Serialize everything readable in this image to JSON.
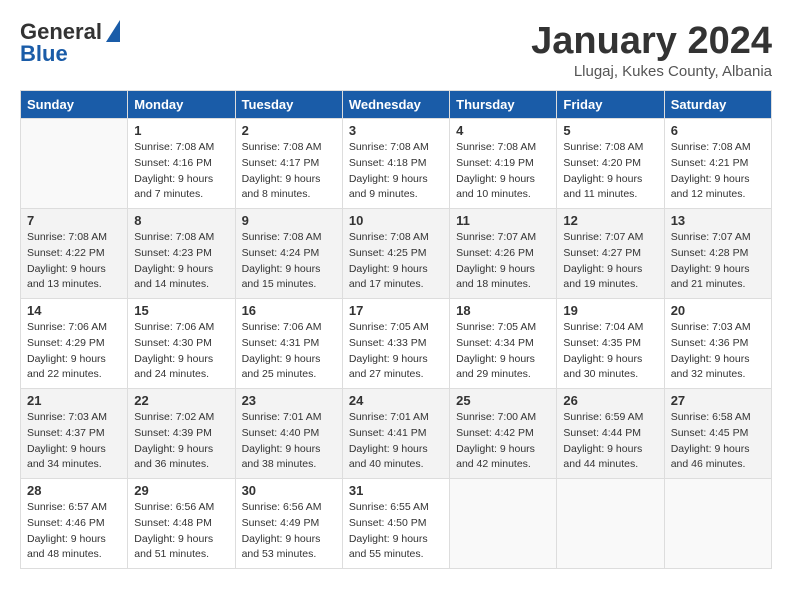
{
  "header": {
    "logo_line1": "General",
    "logo_line2": "Blue",
    "month": "January 2024",
    "location": "Llugaj, Kukes County, Albania"
  },
  "days_of_week": [
    "Sunday",
    "Monday",
    "Tuesday",
    "Wednesday",
    "Thursday",
    "Friday",
    "Saturday"
  ],
  "weeks": [
    [
      {
        "day": "",
        "sunrise": "",
        "sunset": "",
        "daylight": ""
      },
      {
        "day": "1",
        "sunrise": "Sunrise: 7:08 AM",
        "sunset": "Sunset: 4:16 PM",
        "daylight": "Daylight: 9 hours and 7 minutes."
      },
      {
        "day": "2",
        "sunrise": "Sunrise: 7:08 AM",
        "sunset": "Sunset: 4:17 PM",
        "daylight": "Daylight: 9 hours and 8 minutes."
      },
      {
        "day": "3",
        "sunrise": "Sunrise: 7:08 AM",
        "sunset": "Sunset: 4:18 PM",
        "daylight": "Daylight: 9 hours and 9 minutes."
      },
      {
        "day": "4",
        "sunrise": "Sunrise: 7:08 AM",
        "sunset": "Sunset: 4:19 PM",
        "daylight": "Daylight: 9 hours and 10 minutes."
      },
      {
        "day": "5",
        "sunrise": "Sunrise: 7:08 AM",
        "sunset": "Sunset: 4:20 PM",
        "daylight": "Daylight: 9 hours and 11 minutes."
      },
      {
        "day": "6",
        "sunrise": "Sunrise: 7:08 AM",
        "sunset": "Sunset: 4:21 PM",
        "daylight": "Daylight: 9 hours and 12 minutes."
      }
    ],
    [
      {
        "day": "7",
        "sunrise": "",
        "sunset": "",
        "daylight": ""
      },
      {
        "day": "8",
        "sunrise": "Sunrise: 7:08 AM",
        "sunset": "Sunset: 4:23 PM",
        "daylight": "Daylight: 9 hours and 14 minutes."
      },
      {
        "day": "9",
        "sunrise": "Sunrise: 7:08 AM",
        "sunset": "Sunset: 4:24 PM",
        "daylight": "Daylight: 9 hours and 15 minutes."
      },
      {
        "day": "10",
        "sunrise": "Sunrise: 7:08 AM",
        "sunset": "Sunset: 4:25 PM",
        "daylight": "Daylight: 9 hours and 17 minutes."
      },
      {
        "day": "11",
        "sunrise": "Sunrise: 7:07 AM",
        "sunset": "Sunset: 4:26 PM",
        "daylight": "Daylight: 9 hours and 18 minutes."
      },
      {
        "day": "12",
        "sunrise": "Sunrise: 7:07 AM",
        "sunset": "Sunset: 4:27 PM",
        "daylight": "Daylight: 9 hours and 19 minutes."
      },
      {
        "day": "13",
        "sunrise": "Sunrise: 7:07 AM",
        "sunset": "Sunset: 4:28 PM",
        "daylight": "Daylight: 9 hours and 21 minutes."
      }
    ],
    [
      {
        "day": "14",
        "sunrise": "",
        "sunset": "",
        "daylight": ""
      },
      {
        "day": "15",
        "sunrise": "Sunrise: 7:06 AM",
        "sunset": "Sunset: 4:30 PM",
        "daylight": "Daylight: 9 hours and 24 minutes."
      },
      {
        "day": "16",
        "sunrise": "Sunrise: 7:06 AM",
        "sunset": "Sunset: 4:31 PM",
        "daylight": "Daylight: 9 hours and 25 minutes."
      },
      {
        "day": "17",
        "sunrise": "Sunrise: 7:05 AM",
        "sunset": "Sunset: 4:33 PM",
        "daylight": "Daylight: 9 hours and 27 minutes."
      },
      {
        "day": "18",
        "sunrise": "Sunrise: 7:05 AM",
        "sunset": "Sunset: 4:34 PM",
        "daylight": "Daylight: 9 hours and 29 minutes."
      },
      {
        "day": "19",
        "sunrise": "Sunrise: 7:04 AM",
        "sunset": "Sunset: 4:35 PM",
        "daylight": "Daylight: 9 hours and 30 minutes."
      },
      {
        "day": "20",
        "sunrise": "Sunrise: 7:03 AM",
        "sunset": "Sunset: 4:36 PM",
        "daylight": "Daylight: 9 hours and 32 minutes."
      }
    ],
    [
      {
        "day": "21",
        "sunrise": "",
        "sunset": "",
        "daylight": ""
      },
      {
        "day": "22",
        "sunrise": "Sunrise: 7:02 AM",
        "sunset": "Sunset: 4:39 PM",
        "daylight": "Daylight: 9 hours and 36 minutes."
      },
      {
        "day": "23",
        "sunrise": "Sunrise: 7:01 AM",
        "sunset": "Sunset: 4:40 PM",
        "daylight": "Daylight: 9 hours and 38 minutes."
      },
      {
        "day": "24",
        "sunrise": "Sunrise: 7:01 AM",
        "sunset": "Sunset: 4:41 PM",
        "daylight": "Daylight: 9 hours and 40 minutes."
      },
      {
        "day": "25",
        "sunrise": "Sunrise: 7:00 AM",
        "sunset": "Sunset: 4:42 PM",
        "daylight": "Daylight: 9 hours and 42 minutes."
      },
      {
        "day": "26",
        "sunrise": "Sunrise: 6:59 AM",
        "sunset": "Sunset: 4:44 PM",
        "daylight": "Daylight: 9 hours and 44 minutes."
      },
      {
        "day": "27",
        "sunrise": "Sunrise: 6:58 AM",
        "sunset": "Sunset: 4:45 PM",
        "daylight": "Daylight: 9 hours and 46 minutes."
      }
    ],
    [
      {
        "day": "28",
        "sunrise": "",
        "sunset": "",
        "daylight": ""
      },
      {
        "day": "29",
        "sunrise": "Sunrise: 6:56 AM",
        "sunset": "Sunset: 4:48 PM",
        "daylight": "Daylight: 9 hours and 51 minutes."
      },
      {
        "day": "30",
        "sunrise": "Sunrise: 6:56 AM",
        "sunset": "Sunset: 4:49 PM",
        "daylight": "Daylight: 9 hours and 53 minutes."
      },
      {
        "day": "31",
        "sunrise": "Sunrise: 6:55 AM",
        "sunset": "Sunset: 4:50 PM",
        "daylight": "Daylight: 9 hours and 55 minutes."
      },
      {
        "day": "",
        "sunrise": "",
        "sunset": "",
        "daylight": ""
      },
      {
        "day": "",
        "sunrise": "",
        "sunset": "",
        "daylight": ""
      },
      {
        "day": "",
        "sunrise": "",
        "sunset": "",
        "daylight": ""
      }
    ]
  ],
  "week7_sunday": {
    "sunrise": "Sunrise: 7:08 AM",
    "sunset": "Sunset: 4:22 PM",
    "daylight": "Daylight: 9 hours and 13 minutes."
  },
  "week14_sunday": {
    "sunrise": "Sunrise: 7:06 AM",
    "sunset": "Sunset: 4:29 PM",
    "daylight": "Daylight: 9 hours and 22 minutes."
  },
  "week21_sunday": {
    "sunrise": "Sunrise: 7:03 AM",
    "sunset": "Sunset: 4:37 PM",
    "daylight": "Daylight: 9 hours and 34 minutes."
  },
  "week28_sunday": {
    "sunrise": "Sunrise: 6:57 AM",
    "sunset": "Sunset: 4:46 PM",
    "daylight": "Daylight: 9 hours and 48 minutes."
  }
}
